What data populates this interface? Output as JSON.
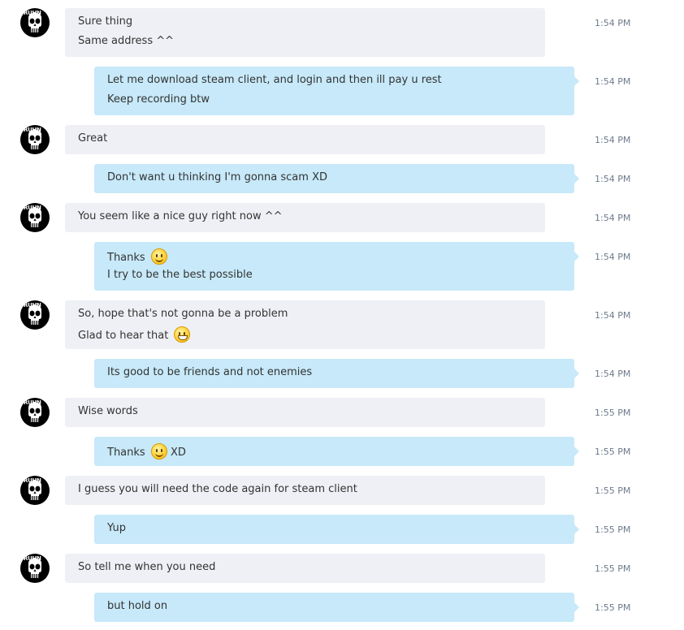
{
  "messages": [
    {
      "dir": "in",
      "time": "1:54 PM",
      "lines": [
        [
          "Sure thing"
        ],
        [
          "Same address ^^"
        ]
      ]
    },
    {
      "dir": "out",
      "time": "1:54 PM",
      "lines": [
        [
          "Let me download steam client, and login and then ill pay u rest"
        ],
        [
          "Keep recording btw"
        ]
      ]
    },
    {
      "dir": "in",
      "time": "1:54 PM",
      "lines": [
        [
          "Great"
        ]
      ]
    },
    {
      "dir": "out",
      "time": "1:54 PM",
      "lines": [
        [
          "Don't want u thinking I'm gonna scam XD"
        ]
      ]
    },
    {
      "dir": "in",
      "time": "1:54 PM",
      "lines": [
        [
          "You seem like a nice guy right now ^^"
        ]
      ]
    },
    {
      "dir": "out",
      "time": "1:54 PM",
      "lines": [
        [
          "Thanks ",
          {
            "emoticon": "smile-emoticon"
          }
        ],
        [
          "I try to be the best possible"
        ]
      ]
    },
    {
      "dir": "in",
      "time": "1:54 PM",
      "lines": [
        [
          "So, hope that's not gonna be a problem"
        ],
        [
          "Glad to hear that ",
          {
            "emoticon": "grin-emoticon"
          }
        ]
      ]
    },
    {
      "dir": "out",
      "time": "1:54 PM",
      "lines": [
        [
          "Its good to be friends and not enemies"
        ]
      ]
    },
    {
      "dir": "in",
      "time": "1:55 PM",
      "lines": [
        [
          "Wise words"
        ]
      ]
    },
    {
      "dir": "out",
      "time": "1:55 PM",
      "lines": [
        [
          "Thanks ",
          {
            "emoticon": "smile-emoticon"
          },
          " XD"
        ]
      ]
    },
    {
      "dir": "in",
      "time": "1:55 PM",
      "lines": [
        [
          "I guess you will need the code again for steam client"
        ]
      ]
    },
    {
      "dir": "out",
      "time": "1:55 PM",
      "lines": [
        [
          "Yup"
        ]
      ]
    },
    {
      "dir": "in",
      "time": "1:55 PM",
      "lines": [
        [
          "So tell me when you need"
        ]
      ]
    },
    {
      "dir": "out",
      "time": "1:55 PM",
      "lines": [
        [
          "but hold on"
        ]
      ]
    }
  ],
  "avatar": {
    "tag": "RUHN",
    "icon": "skull-avatar-icon"
  },
  "colors": {
    "incoming": "#eef0f5",
    "outgoing": "#c7e9f9",
    "time": "#6d7b8c"
  }
}
